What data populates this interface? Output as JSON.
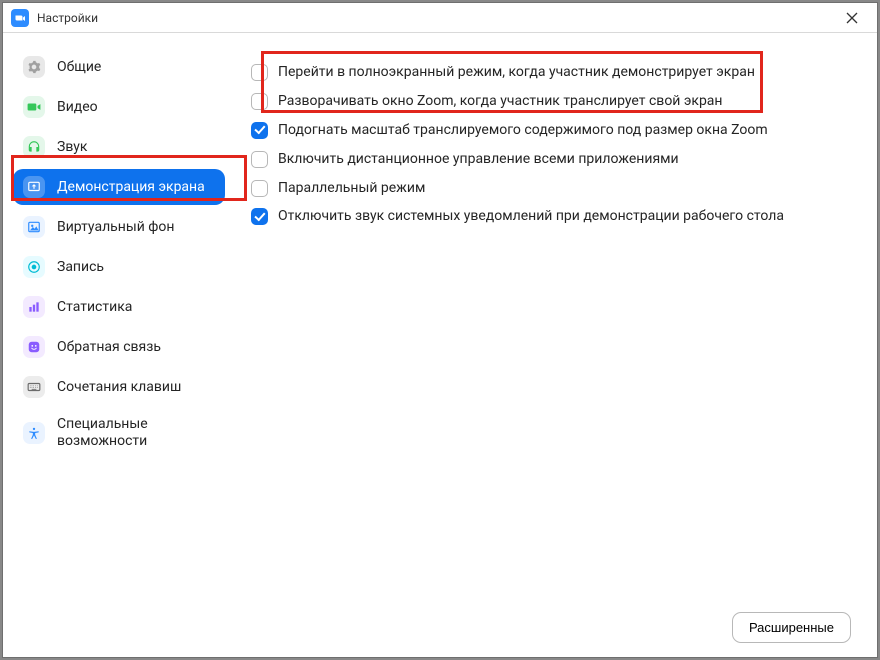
{
  "window": {
    "title": "Настройки",
    "close_tooltip": "Закрыть"
  },
  "sidebar": {
    "items": [
      {
        "id": "general",
        "label": "Общие",
        "icon": "gear",
        "tint": "#e8e8e8",
        "glyph": "#a0a0a0",
        "active": false
      },
      {
        "id": "video",
        "label": "Видео",
        "icon": "camera",
        "tint": "#e4f7ea",
        "glyph": "#34c759",
        "active": false
      },
      {
        "id": "audio",
        "label": "Звук",
        "icon": "headphones",
        "tint": "#e4f7ea",
        "glyph": "#34c759",
        "active": false
      },
      {
        "id": "share-screen",
        "label": "Демонстрация экрана",
        "icon": "share",
        "tint": "#ffffff",
        "glyph": "#ffffff",
        "active": true
      },
      {
        "id": "virtual-bg",
        "label": "Виртуальный фон",
        "icon": "image",
        "tint": "#eaf3ff",
        "glyph": "#2d8cff",
        "active": false
      },
      {
        "id": "recording",
        "label": "Запись",
        "icon": "record",
        "tint": "#e6fbff",
        "glyph": "#00bcd4",
        "active": false
      },
      {
        "id": "statistics",
        "label": "Статистика",
        "icon": "stats",
        "tint": "#f3eaff",
        "glyph": "#8a5cff",
        "active": false
      },
      {
        "id": "feedback",
        "label": "Обратная связь",
        "icon": "smile",
        "tint": "#f3eaff",
        "glyph": "#8a5cff",
        "active": false
      },
      {
        "id": "shortcuts",
        "label": "Сочетания клавиш",
        "icon": "keyboard",
        "tint": "#ececec",
        "glyph": "#6b6b6b",
        "active": false
      },
      {
        "id": "accessibility",
        "label": "Специальные возможности",
        "icon": "accessibility",
        "tint": "#eaf3ff",
        "glyph": "#2d8cff",
        "active": false
      }
    ]
  },
  "main": {
    "options": [
      {
        "id": "fullscreen-on-share",
        "checked": false,
        "label": "Перейти в полноэкранный режим, когда участник демонстрирует экран"
      },
      {
        "id": "maximize-on-share",
        "checked": false,
        "label": "Разворачивать окно Zoom, когда участник транслирует свой экран"
      },
      {
        "id": "fit-to-window",
        "checked": true,
        "label": "Подогнать масштаб транслируемого содержимого под размер окна Zoom"
      },
      {
        "id": "remote-control-all",
        "checked": false,
        "label": "Включить дистанционное управление всеми приложениями"
      },
      {
        "id": "side-by-side",
        "checked": false,
        "label": "Параллельный режим"
      },
      {
        "id": "mute-sys-notifs",
        "checked": true,
        "label": "Отключить звук системных уведомлений при демонстрации рабочего стола"
      }
    ],
    "advanced_button": "Расширенные"
  }
}
